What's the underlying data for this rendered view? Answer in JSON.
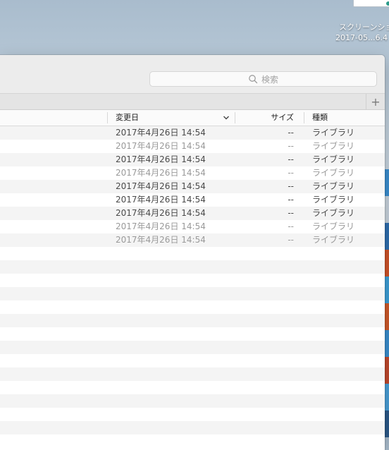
{
  "desktop": {
    "item_label_line1": "スクリーンショ",
    "item_label_line2": "2017-05...6.4",
    "right_strip_colors": [
      "#3b8fd1",
      "#c9d4de",
      "#2f6fb0",
      "#d0542a",
      "#3da0d8",
      "#d05a2a",
      "#3a8fd0",
      "#c24a2e",
      "#4aa0d8",
      "#2c5a8a"
    ]
  },
  "toolbar": {
    "search_placeholder": "検索",
    "add_tab_label": "+"
  },
  "columns": {
    "date_modified": "変更日",
    "size": "サイズ",
    "kind": "種類"
  },
  "rows": [
    {
      "date": "2017年4月26日 14:54",
      "size": "--",
      "kind": "ライブラリ",
      "dim": false
    },
    {
      "date": "2017年4月26日 14:54",
      "size": "--",
      "kind": "ライブラリ",
      "dim": true
    },
    {
      "date": "2017年4月26日 14:54",
      "size": "--",
      "kind": "ライブラリ",
      "dim": false
    },
    {
      "date": "2017年4月26日 14:54",
      "size": "--",
      "kind": "ライブラリ",
      "dim": true
    },
    {
      "date": "2017年4月26日 14:54",
      "size": "--",
      "kind": "ライブラリ",
      "dim": false
    },
    {
      "date": "2017年4月26日 14:54",
      "size": "--",
      "kind": "ライブラリ",
      "dim": false
    },
    {
      "date": "2017年4月26日 14:54",
      "size": "--",
      "kind": "ライブラリ",
      "dim": false
    },
    {
      "date": "2017年4月26日 14:54",
      "size": "--",
      "kind": "ライブラリ",
      "dim": true
    },
    {
      "date": "2017年4月26日 14:54",
      "size": "--",
      "kind": "ライブラリ",
      "dim": true
    }
  ],
  "empty_row_count": 14
}
